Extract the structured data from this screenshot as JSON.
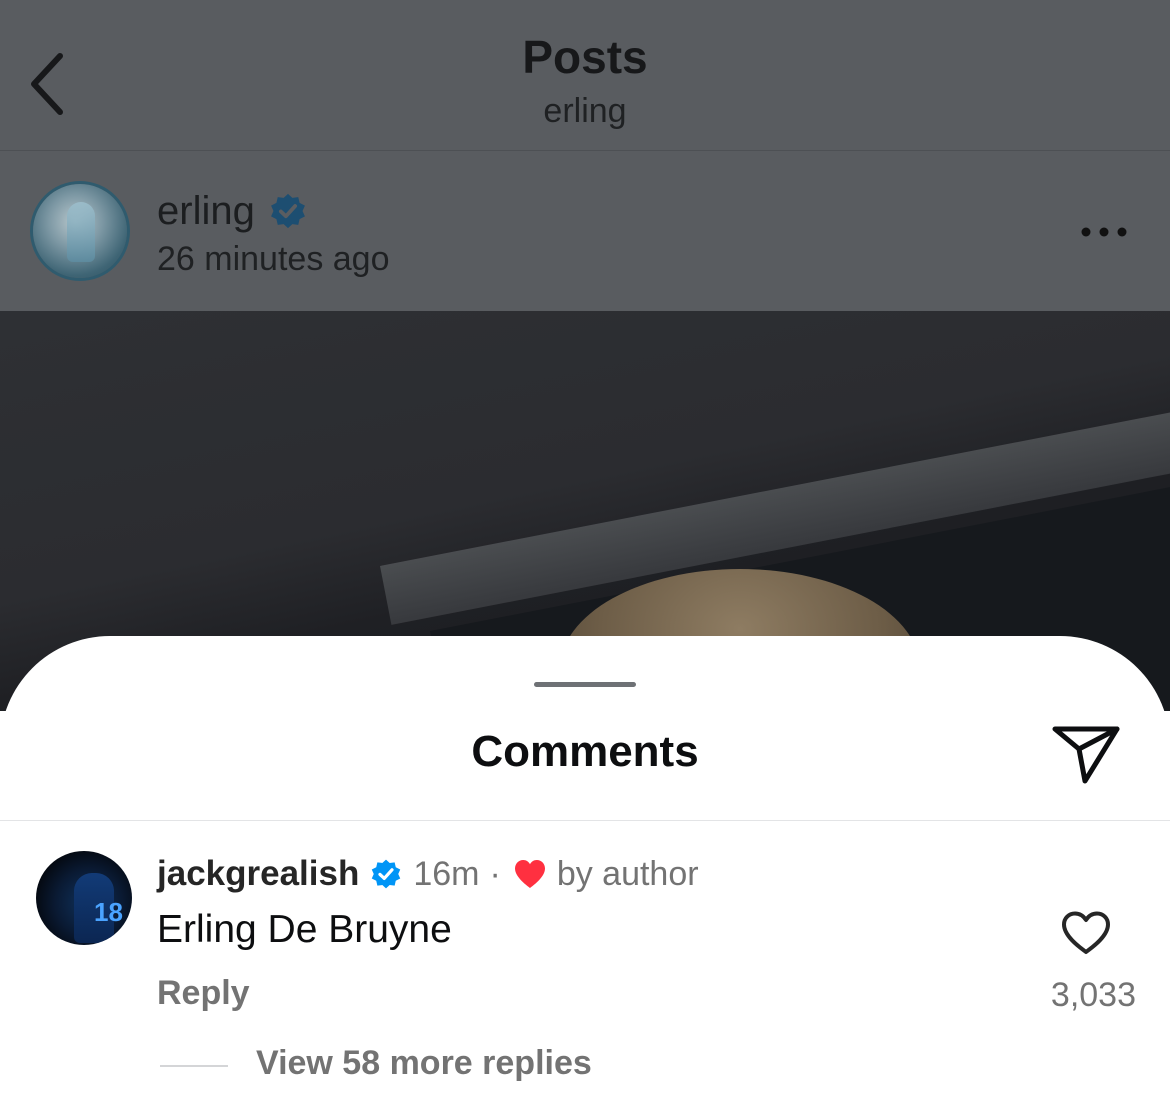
{
  "header": {
    "title": "Posts",
    "subtitle": "erling",
    "back_icon": "chevron-left-icon"
  },
  "post": {
    "username": "erling",
    "verified": true,
    "time": "26 minutes ago",
    "more_icon": "more-horizontal-icon"
  },
  "comments_sheet": {
    "title": "Comments",
    "share_icon": "paper-plane-icon",
    "comment": {
      "username": "jackgrealish",
      "verified": true,
      "time": "16m",
      "separator": "·",
      "liked_by_author_label": "by author",
      "text": "Erling De Bruyne",
      "reply_label": "Reply",
      "like_count": "3,033",
      "view_replies_label": "View 58 more replies"
    }
  },
  "colors": {
    "verified": "#0095f6",
    "author_heart": "#ff3040",
    "secondary_text": "#737373",
    "overlay": "#595c60"
  }
}
